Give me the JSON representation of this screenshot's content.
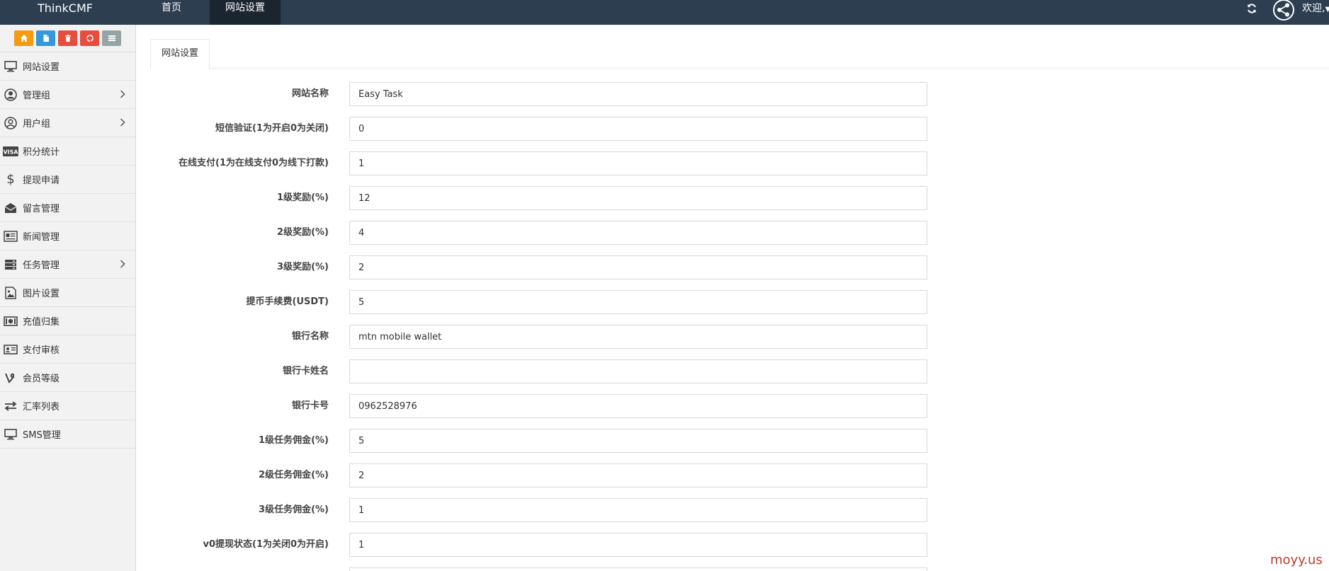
{
  "brand": "ThinkCMF",
  "nav": {
    "items": [
      {
        "label": "首页"
      },
      {
        "label": "网站设置"
      }
    ],
    "welcome": "欢迎,"
  },
  "sidebar": {
    "items": [
      {
        "label": "网站设置",
        "icon": "monitor-icon",
        "expandable": false
      },
      {
        "label": "管理组",
        "icon": "user-circle-icon",
        "expandable": true
      },
      {
        "label": "用户组",
        "icon": "user-outline-icon",
        "expandable": true
      },
      {
        "label": "积分统计",
        "icon": "visa-card-icon",
        "expandable": false
      },
      {
        "label": "提现申请",
        "icon": "dollar-icon",
        "expandable": false
      },
      {
        "label": "留言管理",
        "icon": "envelope-icon",
        "expandable": false
      },
      {
        "label": "新闻管理",
        "icon": "newspaper-icon",
        "expandable": false
      },
      {
        "label": "任务管理",
        "icon": "server-icon",
        "expandable": true
      },
      {
        "label": "图片设置",
        "icon": "image-icon",
        "expandable": false
      },
      {
        "label": "充值归集",
        "icon": "money-icon",
        "expandable": false
      },
      {
        "label": "支付审核",
        "icon": "id-card-icon",
        "expandable": false
      },
      {
        "label": "会员等级",
        "icon": "vine-icon",
        "expandable": false
      },
      {
        "label": "汇率列表",
        "icon": "exchange-icon",
        "expandable": false
      },
      {
        "label": "SMS管理",
        "icon": "monitor-icon",
        "expandable": false
      }
    ]
  },
  "tab": {
    "label": "网站设置"
  },
  "form": {
    "fields": [
      {
        "label": "网站名称",
        "value": "Easy Task"
      },
      {
        "label": "短信验证(1为开启0为关闭)",
        "value": "0"
      },
      {
        "label": "在线支付(1为在线支付0为线下打款)",
        "value": "1"
      },
      {
        "label": "1级奖励(%)",
        "value": "12"
      },
      {
        "label": "2级奖励(%)",
        "value": "4"
      },
      {
        "label": "3级奖励(%)",
        "value": "2"
      },
      {
        "label": "提币手续费(USDT)",
        "value": "5"
      },
      {
        "label": "银行名称",
        "value": "mtn mobile wallet"
      },
      {
        "label": "银行卡姓名",
        "value": ""
      },
      {
        "label": "银行卡号",
        "value": "0962528976"
      },
      {
        "label": "1级任务佣金(%)",
        "value": "5"
      },
      {
        "label": "2级任务佣金(%)",
        "value": "2"
      },
      {
        "label": "3级任务佣金(%)",
        "value": "1"
      },
      {
        "label": "v0提现状态(1为关闭0为开启)",
        "value": "1"
      }
    ]
  },
  "watermark": "moyy.us",
  "colors": {
    "navbar": "#2c3e50",
    "navbar_active": "#1a252f",
    "sidebar_bg": "#f2f2f2",
    "shortcut_orange": "#f39c12",
    "shortcut_blue": "#3498db",
    "shortcut_red": "#e74c3c",
    "shortcut_gray": "#95a5a6",
    "watermark": "#c0392b"
  }
}
